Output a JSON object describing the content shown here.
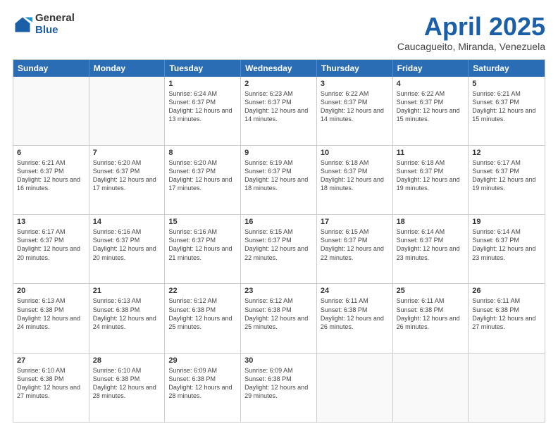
{
  "logo": {
    "general": "General",
    "blue": "Blue"
  },
  "header": {
    "month": "April 2025",
    "location": "Caucagueito, Miranda, Venezuela"
  },
  "days": [
    "Sunday",
    "Monday",
    "Tuesday",
    "Wednesday",
    "Thursday",
    "Friday",
    "Saturday"
  ],
  "weeks": [
    [
      {
        "day": "",
        "info": ""
      },
      {
        "day": "",
        "info": ""
      },
      {
        "day": "1",
        "info": "Sunrise: 6:24 AM\nSunset: 6:37 PM\nDaylight: 12 hours and 13 minutes."
      },
      {
        "day": "2",
        "info": "Sunrise: 6:23 AM\nSunset: 6:37 PM\nDaylight: 12 hours and 14 minutes."
      },
      {
        "day": "3",
        "info": "Sunrise: 6:22 AM\nSunset: 6:37 PM\nDaylight: 12 hours and 14 minutes."
      },
      {
        "day": "4",
        "info": "Sunrise: 6:22 AM\nSunset: 6:37 PM\nDaylight: 12 hours and 15 minutes."
      },
      {
        "day": "5",
        "info": "Sunrise: 6:21 AM\nSunset: 6:37 PM\nDaylight: 12 hours and 15 minutes."
      }
    ],
    [
      {
        "day": "6",
        "info": "Sunrise: 6:21 AM\nSunset: 6:37 PM\nDaylight: 12 hours and 16 minutes."
      },
      {
        "day": "7",
        "info": "Sunrise: 6:20 AM\nSunset: 6:37 PM\nDaylight: 12 hours and 17 minutes."
      },
      {
        "day": "8",
        "info": "Sunrise: 6:20 AM\nSunset: 6:37 PM\nDaylight: 12 hours and 17 minutes."
      },
      {
        "day": "9",
        "info": "Sunrise: 6:19 AM\nSunset: 6:37 PM\nDaylight: 12 hours and 18 minutes."
      },
      {
        "day": "10",
        "info": "Sunrise: 6:18 AM\nSunset: 6:37 PM\nDaylight: 12 hours and 18 minutes."
      },
      {
        "day": "11",
        "info": "Sunrise: 6:18 AM\nSunset: 6:37 PM\nDaylight: 12 hours and 19 minutes."
      },
      {
        "day": "12",
        "info": "Sunrise: 6:17 AM\nSunset: 6:37 PM\nDaylight: 12 hours and 19 minutes."
      }
    ],
    [
      {
        "day": "13",
        "info": "Sunrise: 6:17 AM\nSunset: 6:37 PM\nDaylight: 12 hours and 20 minutes."
      },
      {
        "day": "14",
        "info": "Sunrise: 6:16 AM\nSunset: 6:37 PM\nDaylight: 12 hours and 20 minutes."
      },
      {
        "day": "15",
        "info": "Sunrise: 6:16 AM\nSunset: 6:37 PM\nDaylight: 12 hours and 21 minutes."
      },
      {
        "day": "16",
        "info": "Sunrise: 6:15 AM\nSunset: 6:37 PM\nDaylight: 12 hours and 22 minutes."
      },
      {
        "day": "17",
        "info": "Sunrise: 6:15 AM\nSunset: 6:37 PM\nDaylight: 12 hours and 22 minutes."
      },
      {
        "day": "18",
        "info": "Sunrise: 6:14 AM\nSunset: 6:37 PM\nDaylight: 12 hours and 23 minutes."
      },
      {
        "day": "19",
        "info": "Sunrise: 6:14 AM\nSunset: 6:37 PM\nDaylight: 12 hours and 23 minutes."
      }
    ],
    [
      {
        "day": "20",
        "info": "Sunrise: 6:13 AM\nSunset: 6:38 PM\nDaylight: 12 hours and 24 minutes."
      },
      {
        "day": "21",
        "info": "Sunrise: 6:13 AM\nSunset: 6:38 PM\nDaylight: 12 hours and 24 minutes."
      },
      {
        "day": "22",
        "info": "Sunrise: 6:12 AM\nSunset: 6:38 PM\nDaylight: 12 hours and 25 minutes."
      },
      {
        "day": "23",
        "info": "Sunrise: 6:12 AM\nSunset: 6:38 PM\nDaylight: 12 hours and 25 minutes."
      },
      {
        "day": "24",
        "info": "Sunrise: 6:11 AM\nSunset: 6:38 PM\nDaylight: 12 hours and 26 minutes."
      },
      {
        "day": "25",
        "info": "Sunrise: 6:11 AM\nSunset: 6:38 PM\nDaylight: 12 hours and 26 minutes."
      },
      {
        "day": "26",
        "info": "Sunrise: 6:11 AM\nSunset: 6:38 PM\nDaylight: 12 hours and 27 minutes."
      }
    ],
    [
      {
        "day": "27",
        "info": "Sunrise: 6:10 AM\nSunset: 6:38 PM\nDaylight: 12 hours and 27 minutes."
      },
      {
        "day": "28",
        "info": "Sunrise: 6:10 AM\nSunset: 6:38 PM\nDaylight: 12 hours and 28 minutes."
      },
      {
        "day": "29",
        "info": "Sunrise: 6:09 AM\nSunset: 6:38 PM\nDaylight: 12 hours and 28 minutes."
      },
      {
        "day": "30",
        "info": "Sunrise: 6:09 AM\nSunset: 6:38 PM\nDaylight: 12 hours and 29 minutes."
      },
      {
        "day": "",
        "info": ""
      },
      {
        "day": "",
        "info": ""
      },
      {
        "day": "",
        "info": ""
      }
    ]
  ]
}
